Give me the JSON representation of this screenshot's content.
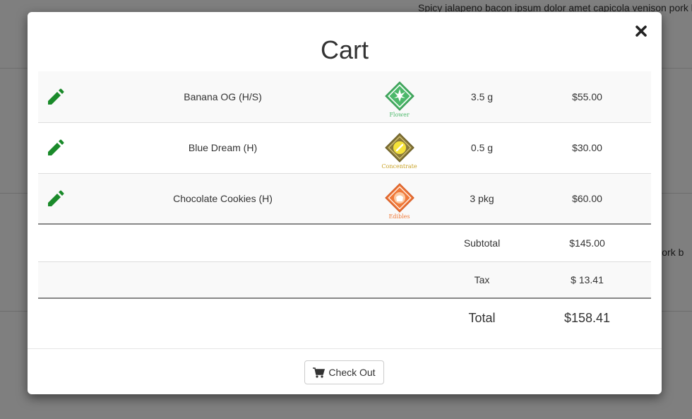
{
  "background": {
    "text_top": "Spicy jalapeno bacon ipsum dolor amet capicola venison pork b",
    "text_mid": "on pork b"
  },
  "modal": {
    "title": "Cart",
    "close_icon": "close-icon",
    "items": [
      {
        "name": "Banana OG (H/S)",
        "category": "Flower",
        "category_color": "#4cb86a",
        "quantity": "3.5 g",
        "price": "$55.00"
      },
      {
        "name": "Blue Dream (H)",
        "category": "Concentrate",
        "category_color": "#c9a227",
        "quantity": "0.5 g",
        "price": "$30.00"
      },
      {
        "name": "Chocolate Cookies (H)",
        "category": "Edibles",
        "category_color": "#f07a3a",
        "quantity": "3 pkg",
        "price": "$60.00"
      }
    ],
    "summary": {
      "subtotal_label": "Subtotal",
      "subtotal_value": "$145.00",
      "tax_label": "Tax",
      "tax_value": "$ 13.41",
      "total_label": "Total",
      "total_value": "$158.41"
    },
    "footer": {
      "checkout_label": "Check Out",
      "checkout_icon": "cart-icon"
    }
  },
  "colors": {
    "edit_icon": "#1a8a2a",
    "overlay": "rgba(0,0,0,0.5)"
  }
}
